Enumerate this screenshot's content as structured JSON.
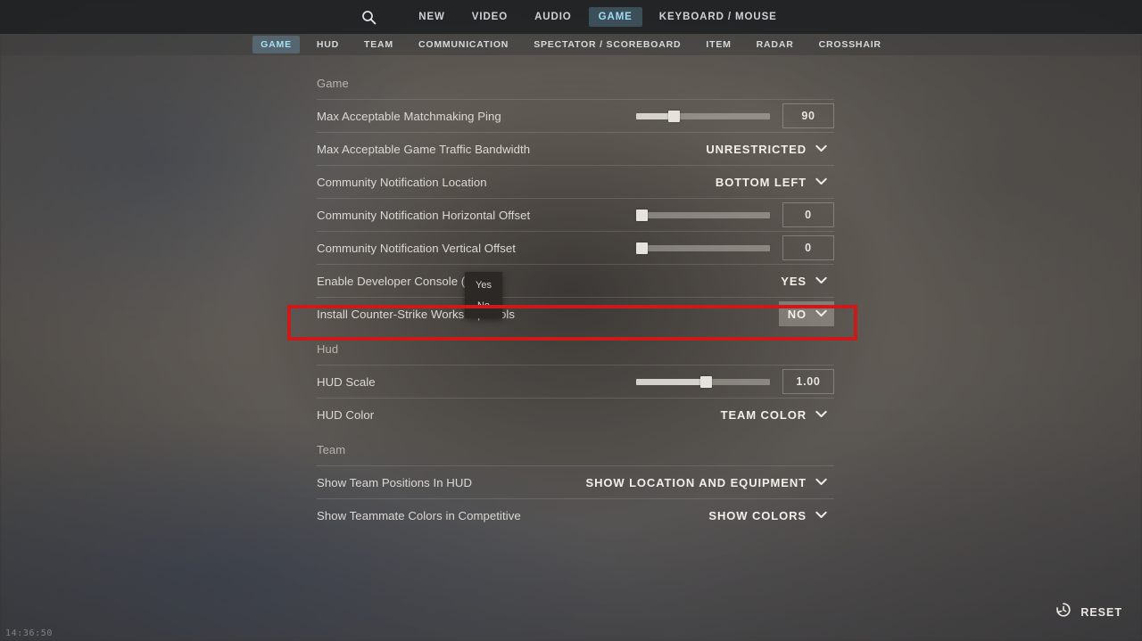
{
  "window": {
    "clock": "14:36:50"
  },
  "topbar": {
    "search_icon": "search-icon",
    "tabs": [
      {
        "label": "NEW",
        "active": false
      },
      {
        "label": "VIDEO",
        "active": false
      },
      {
        "label": "AUDIO",
        "active": false
      },
      {
        "label": "GAME",
        "active": true
      },
      {
        "label": "KEYBOARD / MOUSE",
        "active": false
      }
    ]
  },
  "subtabs": [
    {
      "label": "GAME",
      "active": true
    },
    {
      "label": "HUD",
      "active": false
    },
    {
      "label": "TEAM",
      "active": false
    },
    {
      "label": "COMMUNICATION",
      "active": false
    },
    {
      "label": "SPECTATOR / SCOREBOARD",
      "active": false
    },
    {
      "label": "ITEM",
      "active": false
    },
    {
      "label": "RADAR",
      "active": false
    },
    {
      "label": "CROSSHAIR",
      "active": false
    }
  ],
  "sections": [
    {
      "title": "Game",
      "rows": [
        {
          "label": "Max Acceptable Matchmaking Ping",
          "control": "slider",
          "value": "90",
          "fill_percent": 28
        },
        {
          "label": "Max Acceptable Game Traffic Bandwidth",
          "control": "dropdown",
          "value": "UNRESTRICTED"
        },
        {
          "label": "Community Notification Location",
          "control": "dropdown",
          "value": "BOTTOM LEFT"
        },
        {
          "label": "Community Notification Horizontal Offset",
          "control": "slider",
          "value": "0",
          "fill_percent": 4
        },
        {
          "label": "Community Notification Vertical Offset",
          "control": "slider",
          "value": "0",
          "fill_percent": 4
        },
        {
          "label": "Enable Developer Console (~)",
          "control": "dropdown",
          "value": "YES"
        },
        {
          "label": "Install Counter-Strike Workshop Tools",
          "control": "dropdown",
          "value": "NO",
          "open": true
        }
      ]
    },
    {
      "title": "Hud",
      "rows": [
        {
          "label": "HUD Scale",
          "control": "slider",
          "value": "1.00",
          "fill_percent": 52
        },
        {
          "label": "HUD Color",
          "control": "dropdown",
          "value": "TEAM COLOR"
        }
      ]
    },
    {
      "title": "Team",
      "rows": [
        {
          "label": "Show Team Positions In HUD",
          "control": "dropdown",
          "value": "SHOW LOCATION AND EQUIPMENT"
        },
        {
          "label": "Show Teammate Colors in Competitive",
          "control": "dropdown",
          "value": "SHOW COLORS"
        }
      ]
    }
  ],
  "open_dropdown": {
    "for_row": "Install Counter-Strike Workshop Tools",
    "options": [
      {
        "label": "Yes"
      },
      {
        "label": "No"
      }
    ]
  },
  "reset": {
    "label": "RESET",
    "icon": "history-restore-icon"
  },
  "annotation": {
    "type": "highlight-box",
    "color": "#cc1a1a",
    "target": "Install Counter-Strike Workshop Tools"
  }
}
